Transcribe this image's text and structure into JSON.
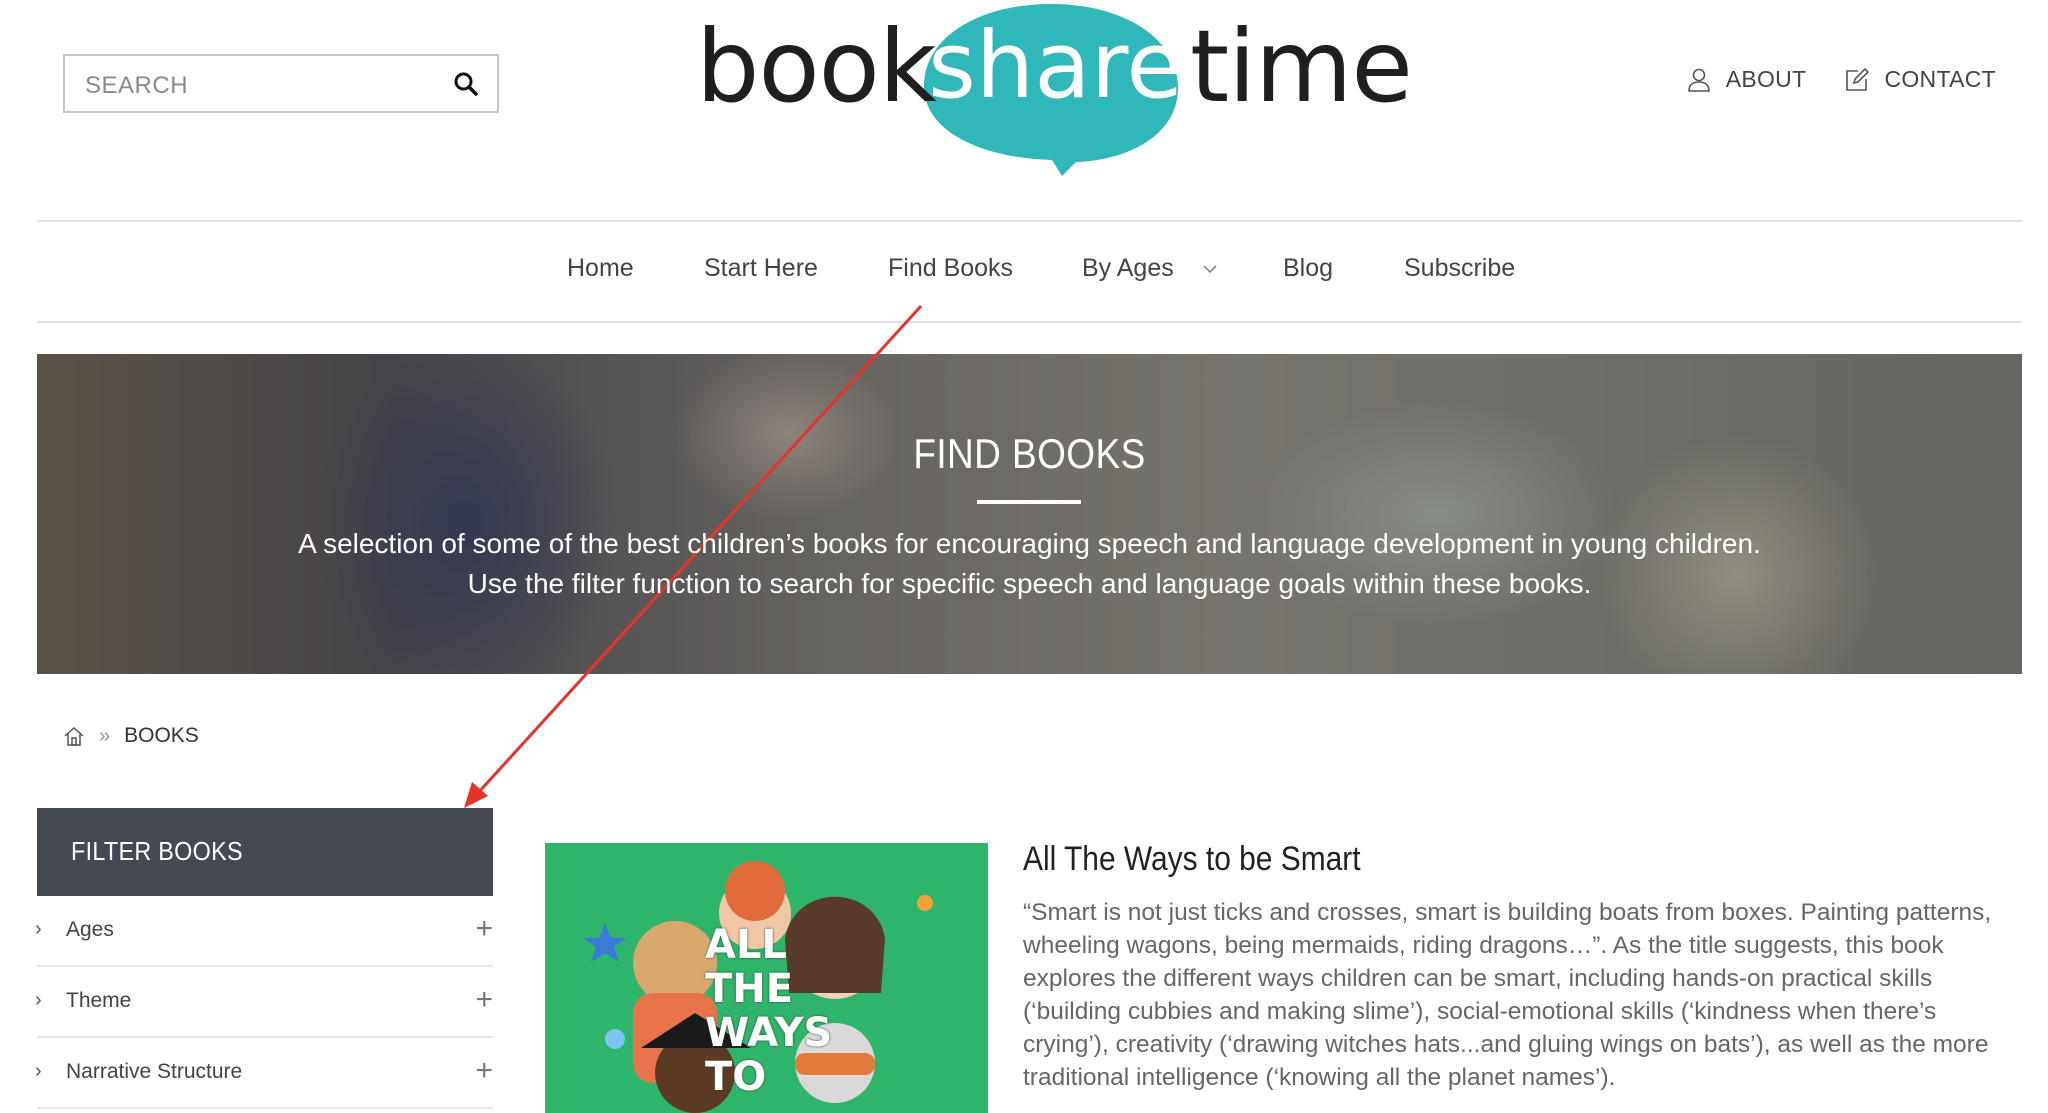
{
  "header": {
    "search_placeholder": "SEARCH",
    "logo": {
      "book": "book",
      "share": "share",
      "time": "time"
    },
    "top_links": [
      {
        "label": "ABOUT",
        "icon": "user-icon"
      },
      {
        "label": "CONTACT",
        "icon": "edit-icon"
      }
    ]
  },
  "nav": {
    "items": [
      "Home",
      "Start Here",
      "Find Books",
      "By Ages",
      "Blog",
      "Subscribe"
    ]
  },
  "hero": {
    "title": "FIND BOOKS",
    "line1": "A selection of some of the best children’s books for encouraging speech and language development in young children.",
    "line2": "Use the filter function to search for specific speech and language goals within these books."
  },
  "breadcrumb": {
    "current": "BOOKS"
  },
  "sidebar": {
    "title": "FILTER BOOKS",
    "filters": [
      "Ages",
      "Theme",
      "Narrative Structure"
    ]
  },
  "book": {
    "title": "All The Ways to be Smart",
    "cover_text": [
      "ALL",
      "THE",
      "WAYS",
      "TO"
    ],
    "description": "“Smart is not just ticks and crosses, smart is building boats from boxes. Painting patterns, wheeling wagons, being mermaids, riding dragons…”. As the title suggests, this book explores the different ways children can be smart, including hands-on practical skills (‘building cubbies and making slime’), social-emotional skills (‘kindness when there’s crying’), creativity (‘drawing witches hats...and gluing wings on bats’), as well as the more traditional intelligence (‘knowing all the planet names’)."
  },
  "colors": {
    "brand_teal": "#2fb7b9",
    "annotation_red": "#e8332a",
    "filter_header_bg": "#454a52",
    "cover_green": "#2fb56b"
  }
}
